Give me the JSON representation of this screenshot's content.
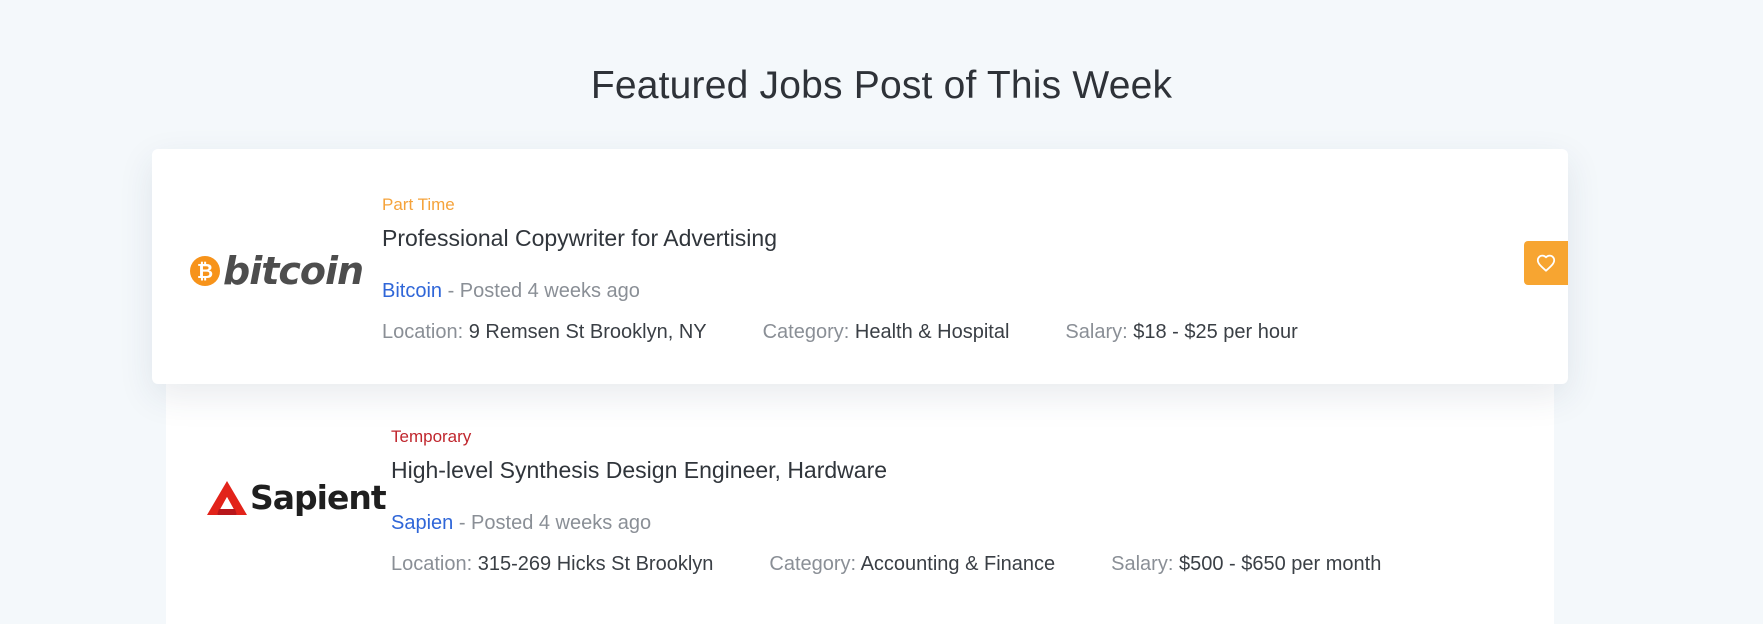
{
  "section": {
    "title": "Featured Jobs Post of This Week"
  },
  "jobs": [
    {
      "type": "Part Time",
      "title": "Professional Copywriter for Advertising",
      "company": "Bitcoin",
      "posted": " - Posted 4 weeks ago",
      "location_label": "Location:",
      "location": "9 Remsen St Brooklyn, NY",
      "category_label": "Category:",
      "category": "Health & Hospital",
      "salary_label": "Salary:",
      "salary": "$18 - $25 per hour",
      "logo": {
        "symbol": "₿",
        "word": "bitcoin"
      },
      "favorite_icon": "heart-outline-icon"
    },
    {
      "type": "Temporary",
      "title": "High-level Synthesis Design Engineer, Hardware",
      "company": "Sapien",
      "posted": " - Posted 4 weeks ago",
      "location_label": "Location:",
      "location": "315-269 Hicks St Brooklyn",
      "category_label": "Category:",
      "category": "Accounting & Finance",
      "salary_label": "Salary:",
      "salary": "$500 - $650 per month",
      "logo": {
        "word": "Sapient"
      }
    }
  ],
  "colors": {
    "background": "#f4f8fb",
    "part_time": "#f5a33b",
    "temporary": "#c0262d",
    "company_link": "#2f66d8",
    "favorite_button": "#f7a531",
    "bitcoin_orange": "#f7931a",
    "sapient_red": "#e2231a"
  }
}
